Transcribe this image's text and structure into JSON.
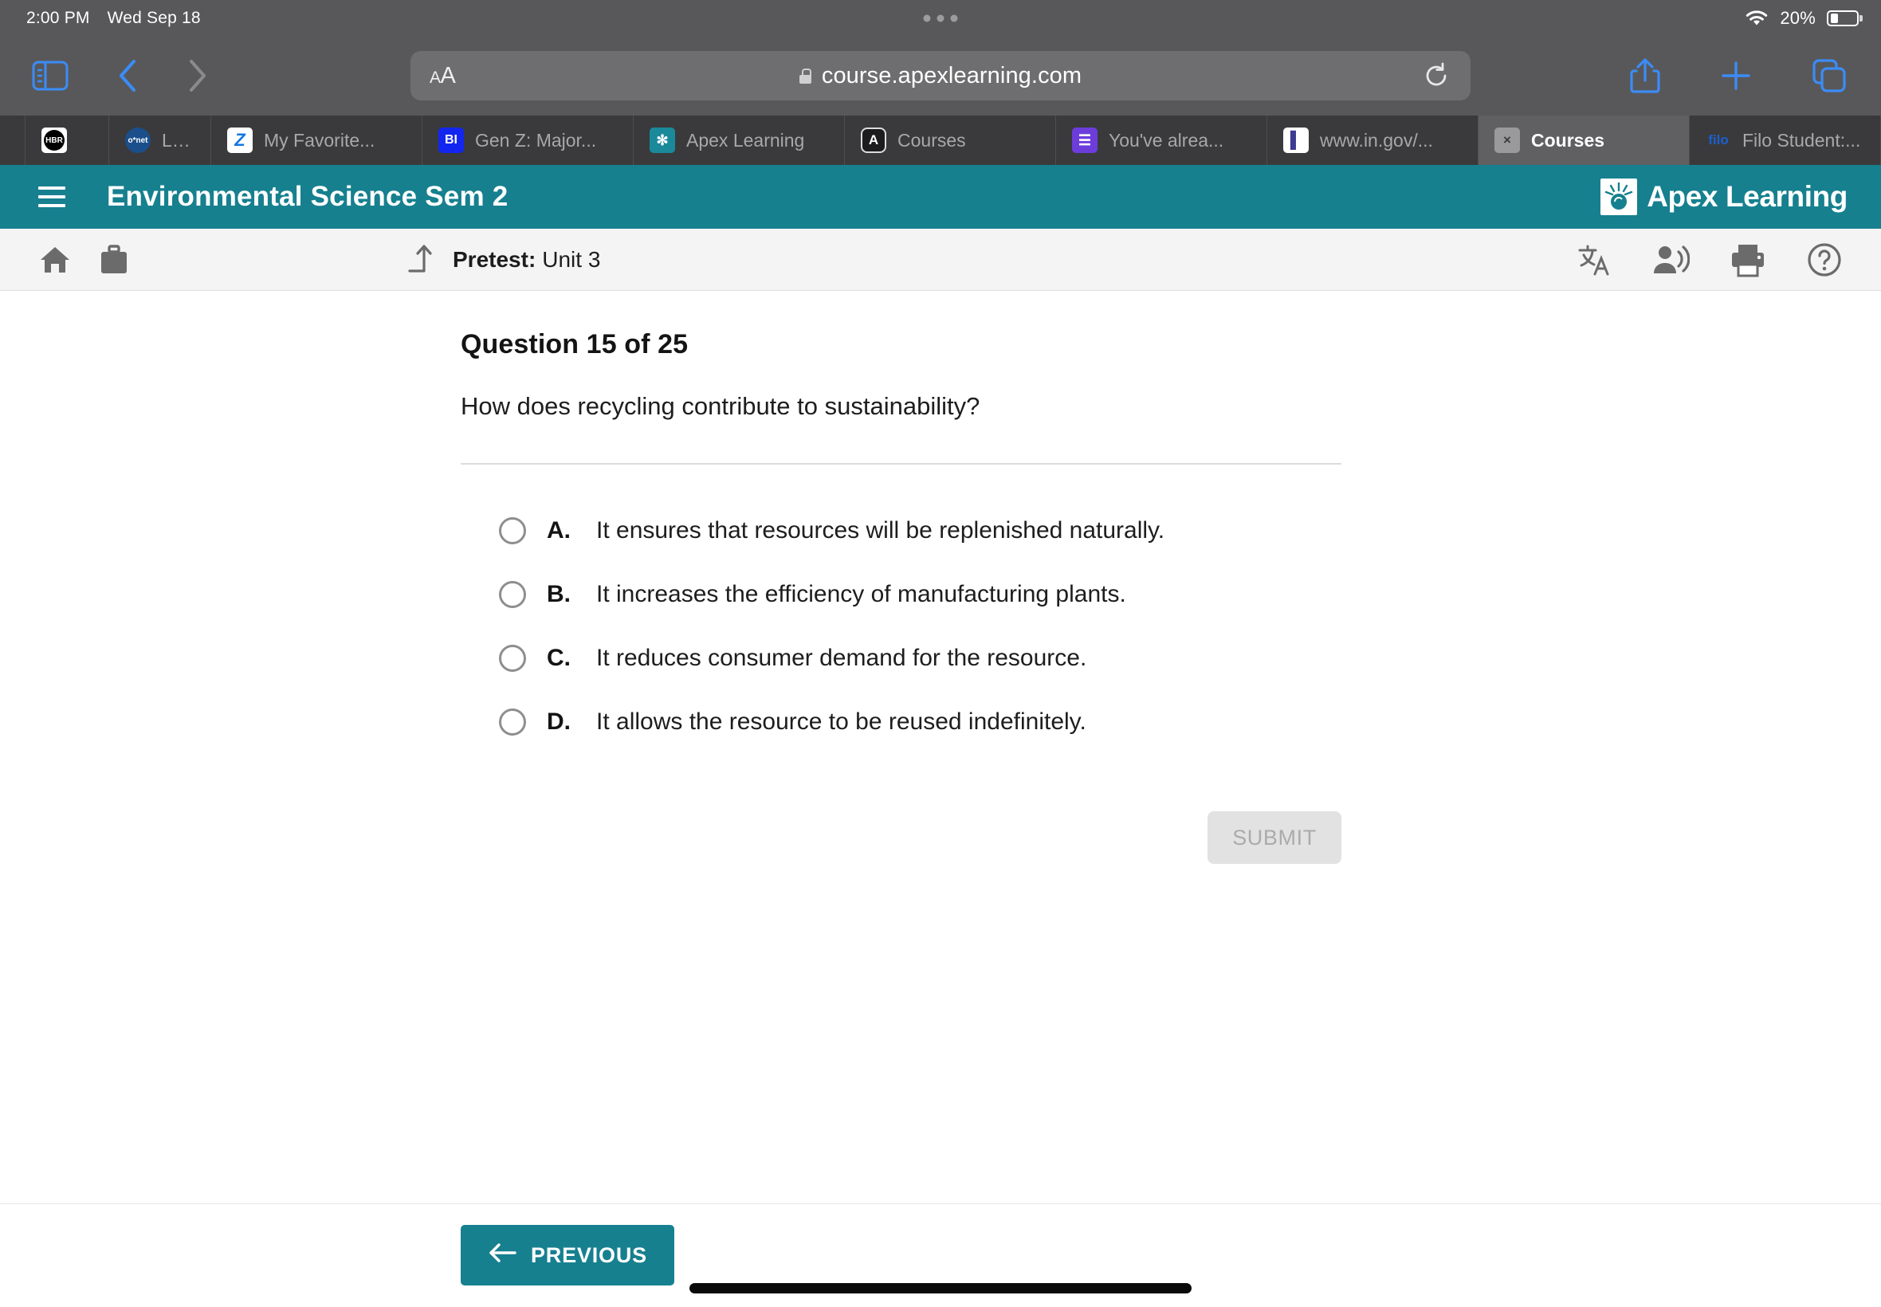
{
  "status_bar": {
    "time": "2:00 PM",
    "date": "Wed Sep 18",
    "battery_percent": "20%",
    "wifi_icon": "wifi-icon",
    "battery_icon": "battery-icon"
  },
  "browser": {
    "url": "course.apexlearning.com",
    "text_size_label": "AA",
    "lock_icon": "lock-icon",
    "reload_icon": "reload-icon",
    "sidebar_icon": "sidebar-icon",
    "back_icon": "chevron-left-icon",
    "forward_icon": "chevron-right-icon",
    "share_icon": "share-icon",
    "new_tab_icon": "plus-icon",
    "tabs_overview_icon": "tab-overview-icon",
    "tabs": [
      {
        "label": "",
        "favicon": "hbr-icon",
        "favicon_text": "HBR",
        "active": false
      },
      {
        "label": "Local",
        "favicon": "onet-icon",
        "favicon_text": "o*net",
        "active": false
      },
      {
        "label": "My Favorite...",
        "favicon": "zillow-icon",
        "favicon_text": "Z",
        "active": false
      },
      {
        "label": "Gen Z: Major...",
        "favicon": "business-insider-icon",
        "favicon_text": "BI",
        "active": false
      },
      {
        "label": "Apex Learning",
        "favicon": "apex-learning-icon",
        "favicon_text": "✻",
        "active": false
      },
      {
        "label": "Courses",
        "favicon": "apex-a-icon",
        "favicon_text": "A",
        "active": false
      },
      {
        "label": "You've alrea...",
        "favicon": "google-forms-icon",
        "favicon_text": "☰",
        "active": false
      },
      {
        "label": "www.in.gov/...",
        "favicon": "indiana-gov-icon",
        "favicon_text": "▌",
        "active": false
      },
      {
        "label": "Courses",
        "favicon": "close-icon",
        "favicon_text": "×",
        "active": true
      },
      {
        "label": "Filo Student:...",
        "favicon": "filo-icon",
        "favicon_text": "filo",
        "active": false
      }
    ]
  },
  "app_header": {
    "menu_icon": "hamburger-menu-icon",
    "course_title": "Environmental Science Sem 2",
    "logo_text": "Apex Learning",
    "logo_mark": "apex-sunburst-icon",
    "brand_color": "#16808f"
  },
  "subnav": {
    "home_icon": "home-icon",
    "briefcase_icon": "briefcase-icon",
    "up_level_icon": "up-level-arrow-icon",
    "breadcrumb_label": "Pretest:",
    "breadcrumb_value": "Unit 3",
    "translate_icon": "translate-icon",
    "read-aloud_icon": "read-aloud-icon",
    "print_icon": "print-icon",
    "help_icon": "help-icon"
  },
  "question": {
    "heading": "Question 15 of 25",
    "number": 15,
    "total": 25,
    "prompt": "How does recycling contribute to sustainability?",
    "options": [
      {
        "letter": "A.",
        "text": "It ensures that resources will be replenished naturally.",
        "selected": false
      },
      {
        "letter": "B.",
        "text": "It increases the efficiency of manufacturing plants.",
        "selected": false
      },
      {
        "letter": "C.",
        "text": "It reduces consumer demand for the resource.",
        "selected": false
      },
      {
        "letter": "D.",
        "text": "It allows the resource to be reused indefinitely.",
        "selected": false
      }
    ],
    "submit_label": "SUBMIT",
    "submit_enabled": false
  },
  "footer": {
    "previous_label": "PREVIOUS",
    "previous_arrow_icon": "arrow-left-icon",
    "home_indicator": "home-indicator"
  }
}
